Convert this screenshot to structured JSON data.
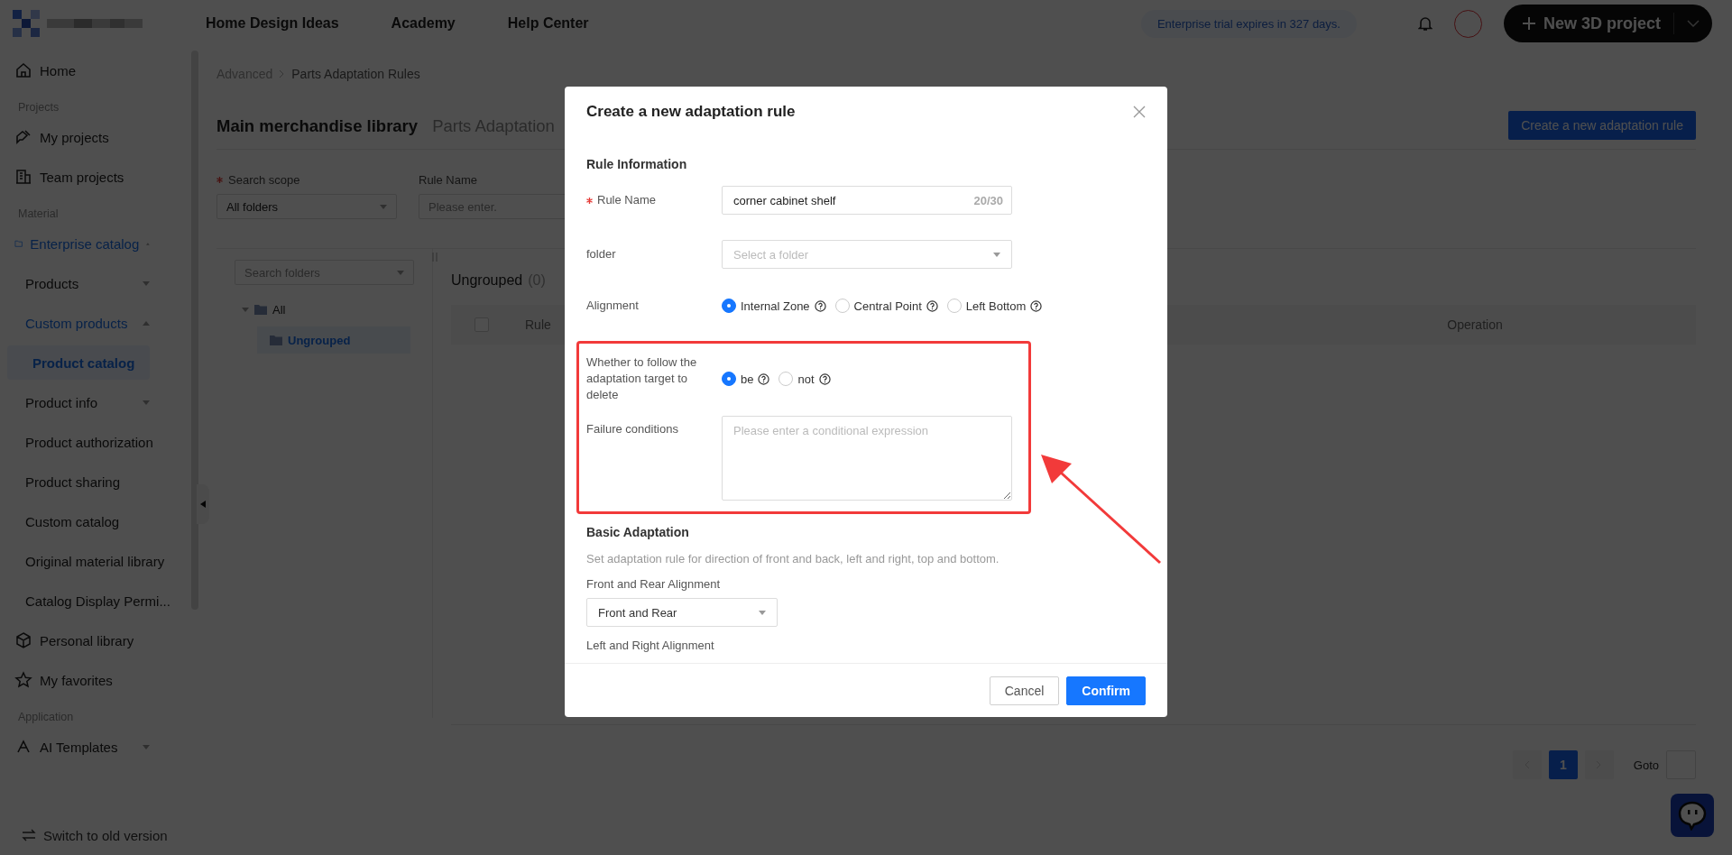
{
  "header": {
    "nav": [
      {
        "label": "Home Design Ideas"
      },
      {
        "label": "Academy"
      },
      {
        "label": "Help Center"
      }
    ],
    "trial_notice": "Enterprise trial expires in 327 days.",
    "new_project_button": "New 3D project"
  },
  "sidebar": {
    "items": [
      {
        "kind": "link",
        "label": "Home",
        "selected": false
      },
      {
        "kind": "section",
        "label": "Projects"
      },
      {
        "kind": "link",
        "label": "My projects",
        "selected": false
      },
      {
        "kind": "link",
        "label": "Team projects",
        "selected": false
      },
      {
        "kind": "section",
        "label": "Material"
      },
      {
        "kind": "group",
        "label": "Enterprise catalog",
        "expanded": true,
        "children": [
          {
            "kind": "group",
            "label": "Products",
            "expanded": false
          },
          {
            "kind": "group",
            "label": "Custom products",
            "expanded": true,
            "children": [
              {
                "kind": "link",
                "label": "Product catalog",
                "selected": true
              }
            ]
          },
          {
            "kind": "group",
            "label": "Product info",
            "expanded": false
          },
          {
            "kind": "link",
            "label": "Product authorization",
            "selected": false
          },
          {
            "kind": "link",
            "label": "Product sharing",
            "selected": false
          },
          {
            "kind": "link",
            "label": "Custom catalog",
            "selected": false
          },
          {
            "kind": "link",
            "label": "Original material library",
            "selected": false
          },
          {
            "kind": "link",
            "label": "Catalog Display Permi...",
            "selected": false
          }
        ]
      },
      {
        "kind": "link",
        "label": "Personal library",
        "selected": false
      },
      {
        "kind": "link",
        "label": "My favorites",
        "selected": false
      },
      {
        "kind": "section",
        "label": "Application"
      },
      {
        "kind": "group",
        "label": "AI Templates",
        "expanded": false
      }
    ],
    "footer": "Switch to old version"
  },
  "breadcrumb": [
    "Advanced",
    "Parts Adaptation Rules"
  ],
  "tabs": [
    {
      "label": "Main merchandise library",
      "selected": true
    },
    {
      "label": "Parts Adaptation",
      "selected": false
    }
  ],
  "create_button": "Create a new adaptation rule",
  "filters": {
    "search_scope": {
      "label": "Search scope",
      "required": true,
      "value": "All folders"
    },
    "rule_name": {
      "label": "Rule Name",
      "placeholder": "Please enter."
    }
  },
  "folder_panel": {
    "search_placeholder": "Search folders",
    "tree": [
      {
        "label": "All",
        "expanded": true,
        "selected": false,
        "children": [
          {
            "label": "Ungrouped",
            "selected": true
          }
        ]
      }
    ]
  },
  "list": {
    "title": "Ungrouped",
    "count": "(0)",
    "select_all": {
      "checked": false
    },
    "columns": [
      "Rule",
      "Operation"
    ]
  },
  "pagination": {
    "pages": [
      {
        "label": "1",
        "selected": true
      }
    ],
    "goto_label": "Goto"
  },
  "dialog": {
    "title": "Create a new adaptation rule",
    "section_title": "Rule Information",
    "rule_name": {
      "label": "Rule Name",
      "required": true,
      "value": "corner cabinet shelf",
      "counter": "20/30"
    },
    "folder": {
      "label": "folder",
      "placeholder": "Select a folder"
    },
    "alignment": {
      "label": "Alignment",
      "options": [
        {
          "label": "Internal Zone",
          "selected": true
        },
        {
          "label": "Central Point",
          "selected": false
        },
        {
          "label": "Left Bottom",
          "selected": false
        }
      ]
    },
    "follow_delete": {
      "label": "Whether to follow the adaptation target to delete",
      "options": [
        {
          "label": "be",
          "selected": true
        },
        {
          "label": "not",
          "selected": false
        }
      ]
    },
    "failure_conditions": {
      "label": "Failure conditions",
      "placeholder": "Please enter a conditional expression"
    },
    "basic": {
      "title": "Basic Adaptation",
      "description": "Set adaptation rule for direction of front and back, left and right, top and bottom.",
      "front_rear": {
        "label": "Front and Rear Alignment",
        "value": "Front and Rear"
      },
      "left_right": {
        "label": "Left and Right Alignment"
      }
    },
    "buttons": [
      {
        "label": "Cancel",
        "kind": "secondary"
      },
      {
        "label": "Confirm",
        "kind": "primary"
      }
    ]
  }
}
